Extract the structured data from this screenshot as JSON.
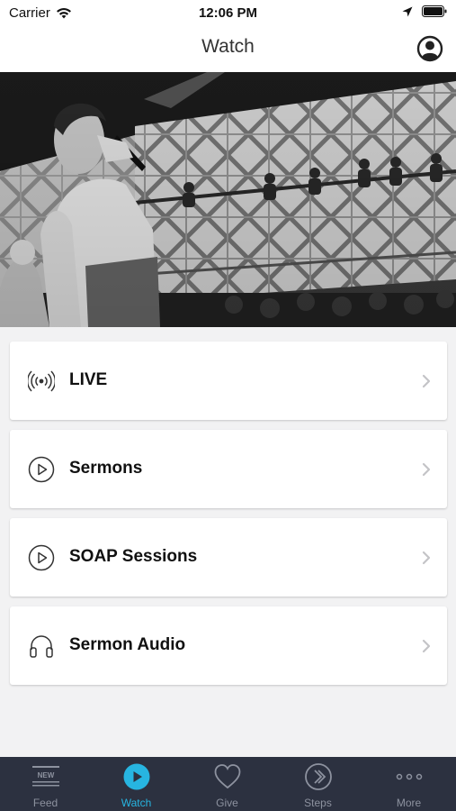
{
  "status_bar": {
    "carrier": "Carrier",
    "time": "12:06 PM",
    "icons": [
      "wifi-icon",
      "location-arrow-icon",
      "battery-icon"
    ]
  },
  "nav": {
    "title": "Watch",
    "profile_icon": "profile-icon"
  },
  "hero": {
    "description_icon": "hero-photo"
  },
  "menu": {
    "items": [
      {
        "label": "LIVE",
        "icon": "broadcast-icon"
      },
      {
        "label": "Sermons",
        "icon": "play-circle-icon"
      },
      {
        "label": "SOAP Sessions",
        "icon": "play-circle-icon"
      },
      {
        "label": "Sermon Audio",
        "icon": "headphones-icon"
      }
    ]
  },
  "tab_bar": {
    "tabs": [
      {
        "label": "Feed",
        "icon": "feed-new-icon",
        "active": false
      },
      {
        "label": "Watch",
        "icon": "play-icon",
        "active": true
      },
      {
        "label": "Give",
        "icon": "heart-icon",
        "active": false
      },
      {
        "label": "Steps",
        "icon": "steps-icon",
        "active": false
      },
      {
        "label": "More",
        "icon": "more-dots-icon",
        "active": false
      }
    ],
    "feed_badge_text": "NEW"
  },
  "colors": {
    "accent": "#27b5e1",
    "tab_bar_bg": "#2c3140",
    "tab_inactive": "#8d929f",
    "page_bg": "#f2f2f3"
  }
}
